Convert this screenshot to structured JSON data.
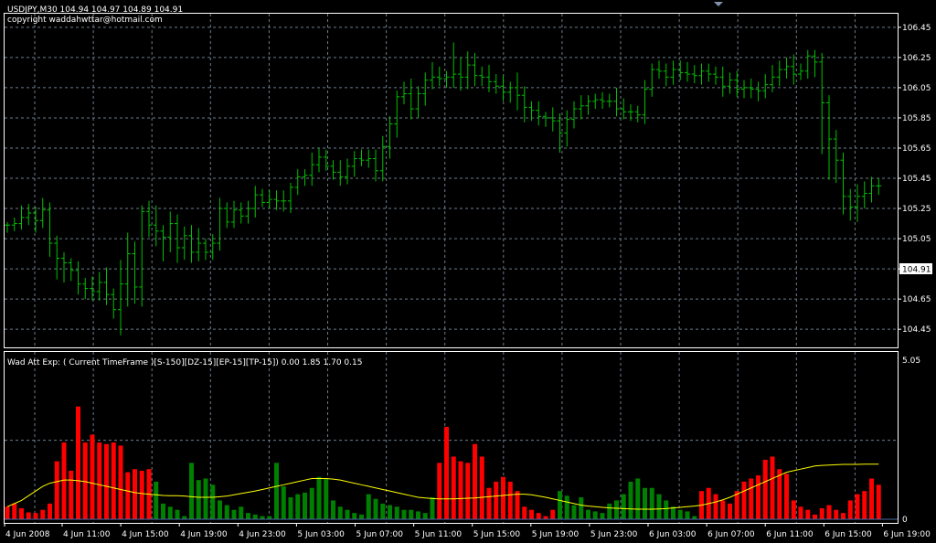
{
  "header": {
    "symbol_line": "USDJPY,M30  104.94 104.97 104.89 104.91",
    "copyright": "copyright waddahwttar@hotmail.com"
  },
  "indicator": {
    "label": "Wad Att Exp: ( Current TimeFrame )[S-150][DZ-15][EP-15][TP-15]) 0.00 1.85 1.70 0.15"
  },
  "colors": {
    "background": "#000000",
    "grid": "#6e7b8b",
    "border": "#ffffff",
    "price_bars": "#00c000",
    "bull_histogram": "#008000",
    "bear_histogram": "#ff0000",
    "signal_line": "#ffff00",
    "price_label_bg": "#ffffff"
  },
  "chart_data": [
    {
      "type": "ohlc",
      "panel": "price",
      "grid": true,
      "current_price": 104.91,
      "current_price_label": "104.91",
      "ylim": [
        104.33,
        106.54
      ],
      "y_ticks": [
        "106.45",
        "106.25",
        "106.05",
        "105.85",
        "105.65",
        "105.45",
        "105.25",
        "105.05",
        "104.85",
        "104.65",
        "104.45"
      ],
      "x_labels": [
        "4 Jun 2008",
        "4 Jun 11:00",
        "4 Jun 15:00",
        "4 Jun 19:00",
        "4 Jun 23:00",
        "5 Jun 03:00",
        "5 Jun 07:00",
        "5 Jun 11:00",
        "5 Jun 15:00",
        "5 Jun 19:00",
        "5 Jun 23:00",
        "6 Jun 03:00",
        "6 Jun 07:00",
        "6 Jun 11:00",
        "6 Jun 15:00",
        "6 Jun 19:00"
      ],
      "close": [
        105.14,
        105.15,
        105.19,
        105.22,
        105.17,
        105.24,
        105.02,
        104.92,
        104.89,
        104.84,
        104.75,
        104.72,
        104.7,
        104.76,
        104.68,
        104.58,
        104.75,
        104.95,
        104.73,
        105.23,
        105.14,
        105.1,
        105.06,
        105.15,
        104.99,
        105.07,
        104.96,
        105.02,
        104.96,
        105.02,
        105.25,
        105.16,
        105.24,
        105.2,
        105.25,
        105.34,
        105.29,
        105.31,
        105.3,
        105.3,
        105.39,
        105.46,
        105.47,
        105.54,
        105.59,
        105.53,
        105.49,
        105.46,
        105.53,
        105.58,
        105.57,
        105.58,
        105.5,
        105.66,
        105.81,
        105.99,
        106.01,
        105.91,
        106.01,
        106.1,
        106.12,
        106.11,
        106.12,
        106.14,
        106.12,
        106.2,
        106.13,
        106.12,
        106.09,
        106.06,
        106.02,
        106.05,
        106.0,
        105.92,
        105.9,
        105.86,
        105.85,
        105.83,
        105.75,
        105.84,
        105.91,
        105.93,
        105.96,
        105.97,
        105.96,
        105.96,
        105.91,
        105.89,
        105.89,
        105.87,
        106.04,
        106.17,
        106.16,
        106.12,
        106.17,
        106.15,
        106.14,
        106.13,
        106.16,
        106.14,
        106.12,
        106.06,
        106.1,
        106.04,
        106.05,
        106.04,
        106.03,
        106.07,
        106.12,
        106.17,
        106.19,
        106.14,
        106.16,
        106.26,
        106.22,
        105.95,
        105.71,
        105.57,
        105.33,
        105.26,
        105.33,
        105.35,
        105.4,
        105.4
      ],
      "high_delta": [
        0.02,
        0.04,
        0.08,
        0.06,
        0.04,
        0.08,
        0.05,
        0.05,
        0.04,
        0.03,
        0.06,
        0.04,
        0.08,
        0.07,
        0.1,
        0.04,
        0.16,
        0.14,
        0.08,
        0.04,
        0.07,
        0.13,
        0.04,
        0.08,
        0.06,
        0.06,
        0.07,
        0.1,
        0.03,
        0.06,
        0.07,
        0.04,
        0.06,
        0.05,
        0.05,
        0.06,
        0.04,
        0.06,
        0.06,
        0.07,
        0.03,
        0.05,
        0.04,
        0.08,
        0.06,
        0.05,
        0.04,
        0.08,
        0.05,
        0.05,
        0.06,
        0.06,
        0.06,
        0.07,
        0.05,
        0.04,
        0.08,
        0.1,
        0.05,
        0.05,
        0.1,
        0.07,
        0.04,
        0.21,
        0.11,
        0.09,
        0.08,
        0.06,
        0.08,
        0.05,
        0.07,
        0.04,
        0.1,
        0.06,
        0.04,
        0.06,
        0.03,
        0.07,
        0.05,
        0.06,
        0.05,
        0.07,
        0.04,
        0.04,
        0.05,
        0.05,
        0.09,
        0.07,
        0.05,
        0.04,
        0.06,
        0.04,
        0.06,
        0.05,
        0.06,
        0.06,
        0.07,
        0.06,
        0.05,
        0.05,
        0.05,
        0.07,
        0.05,
        0.06,
        0.05,
        0.06,
        0.05,
        0.07,
        0.08,
        0.06,
        0.06,
        0.08,
        0.05,
        0.04,
        0.04,
        0.06,
        0.05,
        0.06,
        0.05,
        0.05,
        0.08,
        0.08,
        0.06,
        0.05
      ],
      "low_delta": [
        0.05,
        0.04,
        0.04,
        0.05,
        0.08,
        0.05,
        0.09,
        0.14,
        0.13,
        0.07,
        0.07,
        0.07,
        0.06,
        0.06,
        0.07,
        0.06,
        0.17,
        0.15,
        0.11,
        0.13,
        0.08,
        0.1,
        0.16,
        0.1,
        0.1,
        0.08,
        0.07,
        0.06,
        0.05,
        0.05,
        0.05,
        0.04,
        0.04,
        0.05,
        0.05,
        0.06,
        0.03,
        0.04,
        0.06,
        0.07,
        0.08,
        0.05,
        0.06,
        0.07,
        0.05,
        0.03,
        0.05,
        0.06,
        0.05,
        0.07,
        0.04,
        0.05,
        0.07,
        0.07,
        0.08,
        0.09,
        0.05,
        0.07,
        0.06,
        0.08,
        0.06,
        0.05,
        0.06,
        0.07,
        0.09,
        0.08,
        0.07,
        0.06,
        0.07,
        0.05,
        0.06,
        0.07,
        0.1,
        0.1,
        0.07,
        0.06,
        0.06,
        0.07,
        0.13,
        0.09,
        0.06,
        0.07,
        0.06,
        0.05,
        0.05,
        0.04,
        0.05,
        0.05,
        0.06,
        0.05,
        0.06,
        0.05,
        0.05,
        0.06,
        0.05,
        0.05,
        0.05,
        0.05,
        0.06,
        0.05,
        0.05,
        0.07,
        0.05,
        0.05,
        0.06,
        0.06,
        0.07,
        0.05,
        0.05,
        0.06,
        0.06,
        0.07,
        0.04,
        0.05,
        0.1,
        0.34,
        0.27,
        0.15,
        0.12,
        0.09,
        0.1,
        0.08,
        0.06,
        0.06
      ]
    },
    {
      "type": "histogram",
      "panel": "indicator",
      "grid": true,
      "ylim": [
        0,
        5.05
      ],
      "y_ticks": [
        "5.05",
        "0"
      ],
      "values": [
        0.4,
        0.5,
        0.35,
        0.22,
        0.2,
        0.3,
        0.5,
        1.85,
        2.45,
        1.55,
        3.6,
        2.45,
        2.7,
        2.45,
        2.4,
        2.45,
        2.35,
        1.5,
        1.6,
        1.55,
        1.6,
        1.2,
        0.5,
        0.4,
        0.3,
        0.1,
        1.8,
        1.25,
        1.3,
        1.1,
        0.6,
        0.45,
        0.3,
        0.4,
        0.2,
        0.15,
        0.1,
        0.1,
        1.8,
        1.05,
        0.7,
        0.8,
        0.85,
        1.0,
        1.35,
        1.3,
        0.6,
        0.4,
        0.3,
        0.2,
        0.15,
        0.8,
        0.65,
        0.5,
        0.45,
        0.4,
        0.3,
        0.3,
        0.25,
        0.2,
        0.7,
        1.8,
        2.95,
        2.0,
        1.85,
        1.8,
        2.4,
        2.0,
        1.0,
        1.2,
        1.35,
        1.2,
        0.9,
        0.4,
        0.3,
        0.2,
        0.1,
        0.3,
        0.9,
        0.75,
        0.45,
        0.7,
        0.3,
        0.25,
        0.2,
        0.5,
        0.6,
        0.8,
        1.2,
        1.3,
        1.0,
        1.0,
        0.8,
        0.6,
        0.4,
        0.3,
        0.25,
        0.1,
        0.9,
        1.0,
        0.8,
        0.6,
        0.5,
        0.9,
        1.2,
        1.3,
        1.4,
        1.9,
        2.0,
        1.6,
        1.45,
        0.6,
        0.4,
        0.3,
        0.15,
        0.35,
        0.45,
        0.3,
        0.2,
        0.6,
        0.8,
        0.9,
        1.3,
        1.1
      ],
      "colors_index": "0=bear,1=bull",
      "bar_color": [
        0,
        0,
        0,
        0,
        0,
        0,
        0,
        0,
        0,
        0,
        0,
        0,
        0,
        0,
        0,
        0,
        0,
        0,
        0,
        0,
        0,
        1,
        1,
        1,
        1,
        1,
        1,
        1,
        1,
        1,
        1,
        1,
        1,
        1,
        1,
        1,
        1,
        1,
        1,
        1,
        1,
        1,
        1,
        1,
        1,
        1,
        1,
        1,
        1,
        1,
        1,
        1,
        1,
        1,
        1,
        1,
        1,
        1,
        1,
        1,
        1,
        0,
        0,
        0,
        0,
        0,
        0,
        0,
        0,
        0,
        0,
        0,
        0,
        0,
        0,
        0,
        0,
        0,
        1,
        1,
        1,
        1,
        1,
        1,
        1,
        1,
        1,
        1,
        1,
        1,
        1,
        1,
        1,
        1,
        1,
        1,
        1,
        1,
        0,
        0,
        0,
        0,
        0,
        0,
        0,
        0,
        0,
        0,
        0,
        0,
        0,
        0,
        0,
        0,
        0,
        0,
        0,
        0,
        0,
        0,
        0,
        0,
        0,
        0
      ],
      "line": [
        0.4,
        0.5,
        0.6,
        0.75,
        0.9,
        1.05,
        1.15,
        1.2,
        1.25,
        1.25,
        1.23,
        1.2,
        1.15,
        1.1,
        1.05,
        1.0,
        0.95,
        0.9,
        0.85,
        0.82,
        0.8,
        0.78,
        0.76,
        0.75,
        0.75,
        0.74,
        0.72,
        0.7,
        0.7,
        0.7,
        0.72,
        0.74,
        0.78,
        0.82,
        0.86,
        0.9,
        0.95,
        1.0,
        1.05,
        1.1,
        1.15,
        1.2,
        1.25,
        1.3,
        1.3,
        1.3,
        1.28,
        1.25,
        1.2,
        1.15,
        1.1,
        1.05,
        1.0,
        0.95,
        0.9,
        0.85,
        0.8,
        0.75,
        0.7,
        0.68,
        0.66,
        0.65,
        0.65,
        0.65,
        0.66,
        0.67,
        0.68,
        0.7,
        0.72,
        0.74,
        0.76,
        0.78,
        0.8,
        0.8,
        0.78,
        0.74,
        0.7,
        0.65,
        0.6,
        0.55,
        0.5,
        0.45,
        0.42,
        0.4,
        0.38,
        0.36,
        0.35,
        0.34,
        0.33,
        0.32,
        0.32,
        0.32,
        0.33,
        0.34,
        0.36,
        0.38,
        0.4,
        0.42,
        0.45,
        0.5,
        0.55,
        0.62,
        0.7,
        0.8,
        0.9,
        1.0,
        1.1,
        1.2,
        1.3,
        1.4,
        1.5,
        1.55,
        1.6,
        1.65,
        1.7,
        1.72,
        1.73,
        1.74,
        1.75,
        1.75,
        1.75,
        1.76,
        1.76,
        1.76
      ]
    }
  ]
}
